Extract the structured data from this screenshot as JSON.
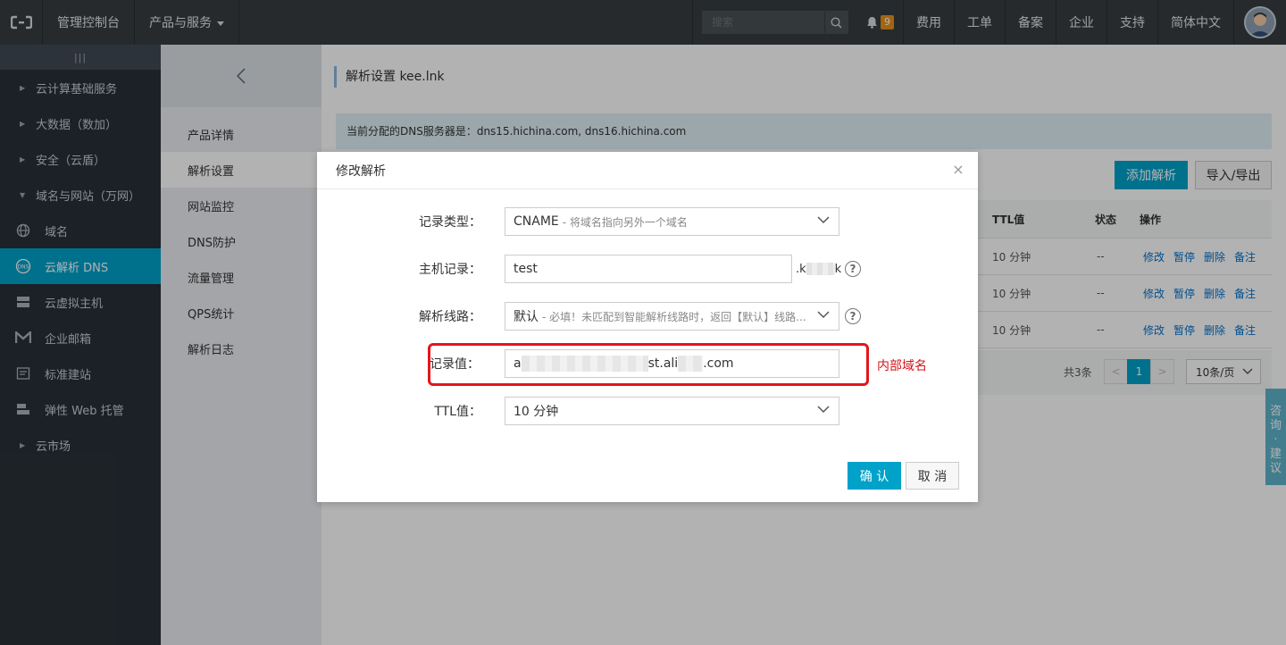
{
  "topbar": {
    "console": "管理控制台",
    "products": "产品与服务",
    "search_placeholder": "搜索",
    "notif_count": "9",
    "links": [
      "费用",
      "工单",
      "备案",
      "企业",
      "支持",
      "简体中文"
    ]
  },
  "sidebar": {
    "collapse": "|||",
    "groups_top": [
      "云计算基础服务",
      "大数据（数加）",
      "安全（云盾）"
    ],
    "open_group": "域名与网站（万网）",
    "items": [
      {
        "label": "域名",
        "icon": "globe-icon"
      },
      {
        "label": "云解析 DNS",
        "icon": "dns-icon"
      },
      {
        "label": "云虚拟主机",
        "icon": "server-icon"
      },
      {
        "label": "企业邮箱",
        "icon": "mail-icon"
      },
      {
        "label": "标准建站",
        "icon": "site-icon"
      },
      {
        "label": "弹性 Web 托管",
        "icon": "hosting-icon"
      }
    ],
    "group_bottom": "云市场"
  },
  "subnav": {
    "back": "‹",
    "items": [
      "产品详情",
      "解析设置",
      "网站监控",
      "DNS防护",
      "流量管理",
      "QPS统计",
      "解析日志"
    ]
  },
  "main": {
    "title": "解析设置 kee.lnk",
    "dns_servers": "当前分配的DNS服务器是：dns15.hichina.com, dns16.hichina.com",
    "add_button": "添加解析",
    "import_button": "导入/导出",
    "table": {
      "headers": {
        "ttl": "TTL值",
        "status": "状态",
        "ops": "操作"
      },
      "rows": [
        {
          "ttl": "10 分钟",
          "status": "--"
        },
        {
          "ttl": "10 分钟",
          "status": "--"
        },
        {
          "ttl": "10 分钟",
          "status": "--"
        }
      ],
      "row_actions": [
        "修改",
        "暂停",
        "删除",
        "备注"
      ]
    },
    "pager": {
      "total": "共3条",
      "prev": "<",
      "current": "1",
      "next": ">",
      "page_size": "10条/页"
    }
  },
  "feedback": [
    "咨",
    "询",
    "·",
    "建",
    "议"
  ],
  "modal": {
    "title": "修改解析",
    "close": "×",
    "fields": {
      "record_type_label": "记录类型：",
      "record_type_value": "CNAME",
      "record_type_desc": "- 将域名指向另外一个域名",
      "host_label": "主机记录：",
      "host_value": "test",
      "host_suffix_start": ".k",
      "host_suffix_end": "k",
      "line_label": "解析线路：",
      "line_value": "默认",
      "line_desc": "- 必填！未匹配到智能解析线路时，返回【默认】线路...",
      "value_label": "记录值：",
      "value_start": "a",
      "value_mid": "st.ali",
      "value_end": ".com",
      "ttl_label": "TTL值：",
      "ttl_value": "10 分钟"
    },
    "annotation": "内部域名",
    "ok": "确 认",
    "cancel": "取 消",
    "help": "?"
  }
}
